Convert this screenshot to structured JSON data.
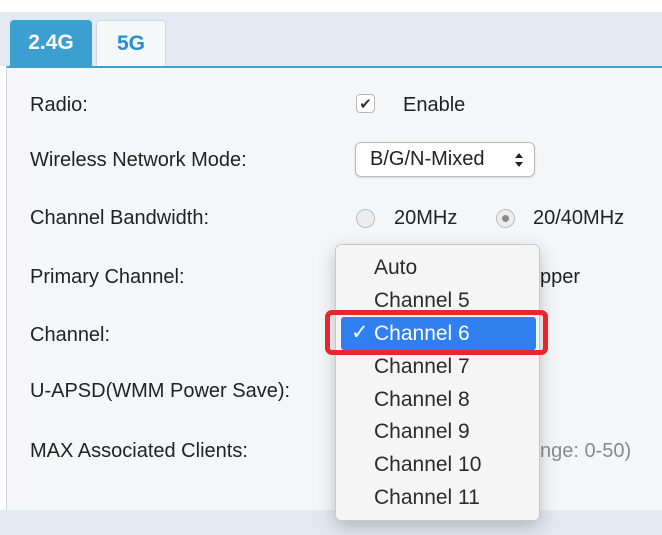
{
  "tabs": [
    {
      "label": "2.4G",
      "active": true
    },
    {
      "label": "5G",
      "active": false
    }
  ],
  "form": {
    "radio": {
      "label": "Radio:",
      "checkbox_checked": true,
      "checkbox_label": "Enable"
    },
    "mode": {
      "label": "Wireless Network Mode:",
      "value": "B/G/N-Mixed"
    },
    "bandwidth": {
      "label": "Channel Bandwidth:",
      "options": [
        "20MHz",
        "20/40MHz"
      ],
      "selected": "20/40MHz"
    },
    "primary": {
      "label": "Primary Channel:",
      "partial_value": "pper"
    },
    "channel": {
      "label": "Channel:"
    },
    "uapsd": {
      "label": "U-APSD(WMM Power Save):"
    },
    "max_clients": {
      "label": "MAX Associated Clients:",
      "partial_hint": "nge: 0-50)"
    }
  },
  "dropdown": {
    "options": [
      "Auto",
      "Channel 5",
      "Channel 6",
      "Channel 7",
      "Channel 8",
      "Channel 9",
      "Channel 10",
      "Channel 11"
    ],
    "selected_index": 2,
    "check_glyph": "✓"
  },
  "colors": {
    "accent": "#3b9fd1",
    "selection": "#2f7ff0",
    "callout": "#e8262b"
  }
}
